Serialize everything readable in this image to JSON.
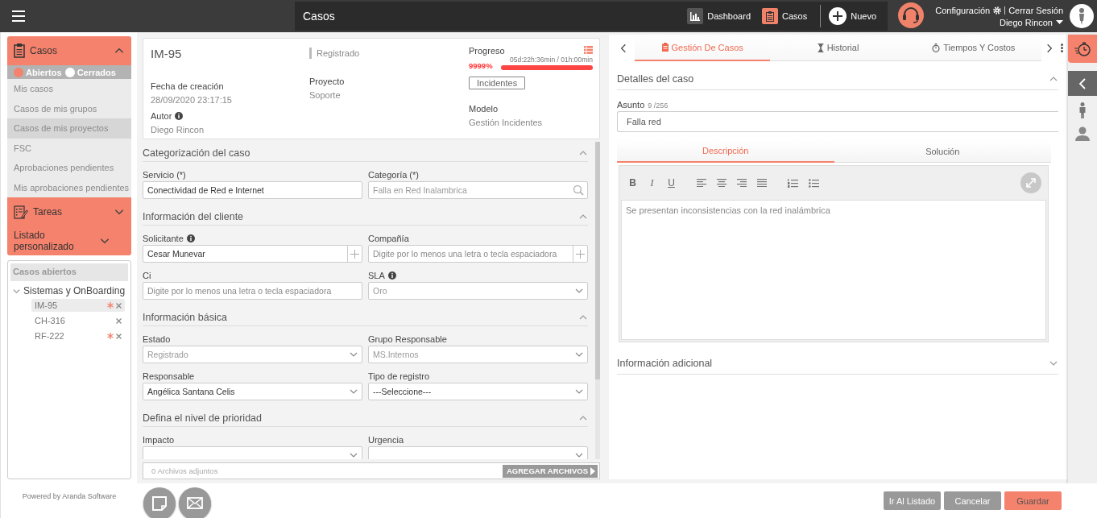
{
  "topbar": {
    "title": "Casos",
    "nav": [
      {
        "kind": "dashboard",
        "label": "Dashboard",
        "selected": false
      },
      {
        "kind": "cases",
        "label": "Casos",
        "selected": true
      },
      {
        "kind": "new",
        "label": "Nuevo",
        "selected": false
      }
    ],
    "settings_link": "Configuración",
    "logout_link": "Cerrar Sesión",
    "user": "Diego Rincon"
  },
  "sidebar": {
    "sections": [
      {
        "kind": "cases",
        "title": "Casos",
        "expanded": true,
        "filters": [
          {
            "label": "Abiertos",
            "selected": true
          },
          {
            "label": "Cerrados",
            "selected": false
          }
        ],
        "items": [
          {
            "label": "Mis casos",
            "selected": false
          },
          {
            "label": "Casos de mis grupos",
            "selected": false
          },
          {
            "label": "Casos de mis proyectos",
            "selected": true
          },
          {
            "label": "FSC",
            "selected": false
          },
          {
            "label": "Aprobaciones pendientes",
            "selected": false
          },
          {
            "label": "Mis aprobaciones pendientes",
            "selected": false
          }
        ]
      },
      {
        "kind": "tasks",
        "title": "Tareas",
        "expanded": false
      },
      {
        "kind": "list",
        "title": "Listado personalizado",
        "expanded": false
      }
    ],
    "open_cases": {
      "title": "Casos abiertos",
      "groups": [
        {
          "label": "Sistemas y OnBoarding",
          "expanded": true,
          "children": [
            {
              "label": "IM-95",
              "selected": true,
              "unsaved": true
            },
            {
              "label": "CH-316",
              "selected": false,
              "unsaved": false
            },
            {
              "label": "RF-222",
              "selected": false,
              "unsaved": true
            }
          ]
        }
      ]
    },
    "footer": "Powered by Aranda Software"
  },
  "case_header": {
    "id": "IM-95",
    "status": "Registrado",
    "created_label": "Fecha de creación",
    "created": "28/09/2020 23:17:15",
    "author_label": "Autor",
    "author": "Diego Rincon",
    "project_label": "Proyecto",
    "project": "Soporte",
    "progress_label": "Progreso",
    "progress_percent": "9999%",
    "progress_time": "05d:22h:36min / 01h:00min",
    "level": 1,
    "type_tag": "Incidentes",
    "model_label": "Modelo",
    "model": "Gestión Incidentes"
  },
  "form": {
    "sections": [
      {
        "title": "Categorización del caso",
        "expanded": true,
        "fields": [
          {
            "label": "Servicio (*)",
            "kind": "text",
            "value": "Conectividad de Red e Internet",
            "disabled": false,
            "info": false
          },
          {
            "label": "Categoría (*)",
            "kind": "search",
            "value": "Falla en Red Inalambrica",
            "disabled": true,
            "info": false
          }
        ]
      },
      {
        "title": "Información del cliente",
        "expanded": true,
        "fields": [
          {
            "label": "Solicitante",
            "kind": "plus",
            "value": "Cesar Munevar",
            "disabled": false,
            "info": true
          },
          {
            "label": "Compañía",
            "kind": "plus",
            "placeholder": "Digite por lo menos una letra o tecla espaciadora",
            "disabled": false,
            "info": false
          },
          {
            "label": "Ci",
            "kind": "text",
            "placeholder": "Digite por lo menos una letra o tecla espaciadora",
            "disabled": false,
            "info": false
          },
          {
            "label": "SLA",
            "kind": "select",
            "value": "Oro",
            "disabled": true,
            "info": true
          }
        ]
      },
      {
        "title": "Información básica",
        "expanded": true,
        "fields": [
          {
            "label": "Estado",
            "kind": "select",
            "value": "Registrado",
            "disabled": true,
            "info": false
          },
          {
            "label": "Grupo Responsable",
            "kind": "select",
            "value": "MS.Internos",
            "disabled": true,
            "info": false
          },
          {
            "label": "Responsable",
            "kind": "select",
            "value": "Angélica Santana Celis",
            "disabled": false,
            "info": false
          },
          {
            "label": "Tipo de registro",
            "kind": "select",
            "value": "---Seleccione---",
            "disabled": false,
            "info": false
          }
        ]
      },
      {
        "title": "Defina el nivel de prioridad",
        "expanded": true,
        "fields": [
          {
            "label": "Impacto",
            "kind": "select",
            "disabled": false,
            "info": false
          },
          {
            "label": "Urgencia",
            "kind": "select",
            "disabled": false,
            "info": false
          }
        ]
      }
    ]
  },
  "attachments": {
    "count": "0 Archivos adjuntos",
    "button": "AGREGAR ARCHIVOS"
  },
  "detail": {
    "tabs": [
      {
        "kind": "cases",
        "label": "Gestión De Casos",
        "selected": true
      },
      {
        "kind": "history",
        "label": "Historial",
        "selected": false
      },
      {
        "kind": "timer",
        "label": "Tiempos Y Costos",
        "selected": false
      }
    ],
    "section": {
      "title": "Detalles del caso",
      "expanded": true
    },
    "subject": {
      "label": "Asunto",
      "counter": "9 /256",
      "value": "Falla red"
    },
    "editor_tabs": [
      {
        "label": "Descripción",
        "selected": true
      },
      {
        "label": "Solución",
        "selected": false
      }
    ],
    "format_buttons": [
      {
        "kind": "bold",
        "label": "B"
      },
      {
        "kind": "italic",
        "label": "I"
      },
      {
        "kind": "underline",
        "label": "U"
      }
    ],
    "editor_text": "Se presentan inconsistencias con la red inalámbrica",
    "extra_section": {
      "title": "Información adicional",
      "expanded": false
    }
  },
  "actions": [
    {
      "label": "Ir Al Listado",
      "kind": "secondary"
    },
    {
      "label": "Cancelar",
      "kind": "secondary"
    },
    {
      "label": "Guardar",
      "kind": "primary"
    }
  ]
}
